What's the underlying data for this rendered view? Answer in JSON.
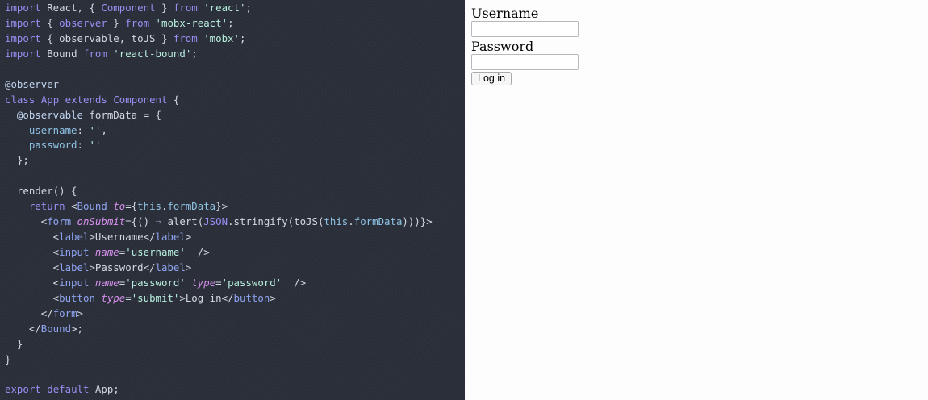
{
  "editor": {
    "theme": {
      "background": "#2b2f3a",
      "text": "#d2d8e2",
      "keyword": "#9a8ff4",
      "string": "#b7eedd",
      "member": "#8fc3e4",
      "decorator": "#c0d4ef",
      "tag": "#8fa4f0",
      "attr": "#d690ed",
      "operator": "#9aa3c6"
    },
    "lines": [
      [
        [
          "kw",
          "import"
        ],
        [
          "t",
          " React, { "
        ],
        [
          "kw",
          "Component"
        ],
        [
          "t",
          " } "
        ],
        [
          "kw",
          "from"
        ],
        [
          "t",
          " "
        ],
        [
          "str",
          "'react'"
        ],
        [
          "t",
          ";"
        ]
      ],
      [
        [
          "kw",
          "import"
        ],
        [
          "t",
          " { "
        ],
        [
          "kw",
          "observer"
        ],
        [
          "t",
          " } "
        ],
        [
          "kw",
          "from"
        ],
        [
          "t",
          " "
        ],
        [
          "str",
          "'mobx-react'"
        ],
        [
          "t",
          ";"
        ]
      ],
      [
        [
          "kw",
          "import"
        ],
        [
          "t",
          " { observable, toJS } "
        ],
        [
          "kw",
          "from"
        ],
        [
          "t",
          " "
        ],
        [
          "str",
          "'mobx'"
        ],
        [
          "t",
          ";"
        ]
      ],
      [
        [
          "kw",
          "import"
        ],
        [
          "t",
          " Bound "
        ],
        [
          "kw",
          "from"
        ],
        [
          "t",
          " "
        ],
        [
          "str",
          "'react-bound'"
        ],
        [
          "t",
          ";"
        ]
      ],
      [],
      [
        [
          "dec",
          "@observer"
        ]
      ],
      [
        [
          "kw",
          "class"
        ],
        [
          "t",
          " "
        ],
        [
          "kw",
          "App"
        ],
        [
          "t",
          " "
        ],
        [
          "kw",
          "extends"
        ],
        [
          "t",
          " "
        ],
        [
          "kw",
          "Component"
        ],
        [
          "t",
          " {"
        ]
      ],
      [
        [
          "t",
          "  "
        ],
        [
          "dec",
          "@observable"
        ],
        [
          "t",
          " formData = {"
        ]
      ],
      [
        [
          "t",
          "    "
        ],
        [
          "mem",
          "username"
        ],
        [
          "t",
          ": "
        ],
        [
          "str",
          "''"
        ],
        [
          "t",
          ","
        ]
      ],
      [
        [
          "t",
          "    "
        ],
        [
          "mem",
          "password"
        ],
        [
          "t",
          ": "
        ],
        [
          "str",
          "''"
        ]
      ],
      [
        [
          "t",
          "  };"
        ]
      ],
      [],
      [
        [
          "t",
          "  render() {"
        ]
      ],
      [
        [
          "t",
          "    "
        ],
        [
          "kw",
          "return"
        ],
        [
          "t",
          " <"
        ],
        [
          "tag",
          "Bound"
        ],
        [
          "t",
          " "
        ],
        [
          "attr",
          "to"
        ],
        [
          "t",
          "={"
        ],
        [
          "mem",
          "this"
        ],
        [
          "t",
          "."
        ],
        [
          "mem",
          "formData"
        ],
        [
          "t",
          "}>"
        ]
      ],
      [
        [
          "t",
          "      <"
        ],
        [
          "tag",
          "form"
        ],
        [
          "t",
          " "
        ],
        [
          "attr",
          "onSubmit"
        ],
        [
          "t",
          "={() "
        ],
        [
          "op",
          "⇒"
        ],
        [
          "t",
          " alert("
        ],
        [
          "kw",
          "JSON"
        ],
        [
          "t",
          ".stringify(toJS("
        ],
        [
          "mem",
          "this"
        ],
        [
          "t",
          "."
        ],
        [
          "mem",
          "formData"
        ],
        [
          "t",
          ")))}>"
        ]
      ],
      [
        [
          "t",
          "        <"
        ],
        [
          "tag",
          "label"
        ],
        [
          "t",
          ">Username</"
        ],
        [
          "tag",
          "label"
        ],
        [
          "t",
          ">"
        ]
      ],
      [
        [
          "t",
          "        <"
        ],
        [
          "tag",
          "input"
        ],
        [
          "t",
          " "
        ],
        [
          "attr",
          "name"
        ],
        [
          "t",
          "="
        ],
        [
          "str",
          "'username'"
        ],
        [
          "t",
          "  />"
        ]
      ],
      [
        [
          "t",
          "        <"
        ],
        [
          "tag",
          "label"
        ],
        [
          "t",
          ">Password</"
        ],
        [
          "tag",
          "label"
        ],
        [
          "t",
          ">"
        ]
      ],
      [
        [
          "t",
          "        <"
        ],
        [
          "tag",
          "input"
        ],
        [
          "t",
          " "
        ],
        [
          "attr",
          "name"
        ],
        [
          "t",
          "="
        ],
        [
          "str",
          "'password'"
        ],
        [
          "t",
          " "
        ],
        [
          "attr",
          "type"
        ],
        [
          "t",
          "="
        ],
        [
          "str",
          "'password'"
        ],
        [
          "t",
          "  />"
        ]
      ],
      [
        [
          "t",
          "        <"
        ],
        [
          "tag",
          "button"
        ],
        [
          "t",
          " "
        ],
        [
          "attr",
          "type"
        ],
        [
          "t",
          "="
        ],
        [
          "str",
          "'submit'"
        ],
        [
          "t",
          ">Log in</"
        ],
        [
          "tag",
          "button"
        ],
        [
          "t",
          ">"
        ]
      ],
      [
        [
          "t",
          "      </"
        ],
        [
          "tag",
          "form"
        ],
        [
          "t",
          ">"
        ]
      ],
      [
        [
          "t",
          "    </"
        ],
        [
          "tag",
          "Bound"
        ],
        [
          "t",
          ">;"
        ]
      ],
      [
        [
          "t",
          "  }"
        ]
      ],
      [
        [
          "t",
          "}"
        ]
      ],
      [],
      [
        [
          "kw",
          "export"
        ],
        [
          "t",
          " "
        ],
        [
          "kw",
          "default"
        ],
        [
          "t",
          " App;"
        ]
      ]
    ]
  },
  "preview": {
    "username_label": "Username",
    "username_value": "",
    "password_label": "Password",
    "password_value": "",
    "login_button": "Log in"
  }
}
